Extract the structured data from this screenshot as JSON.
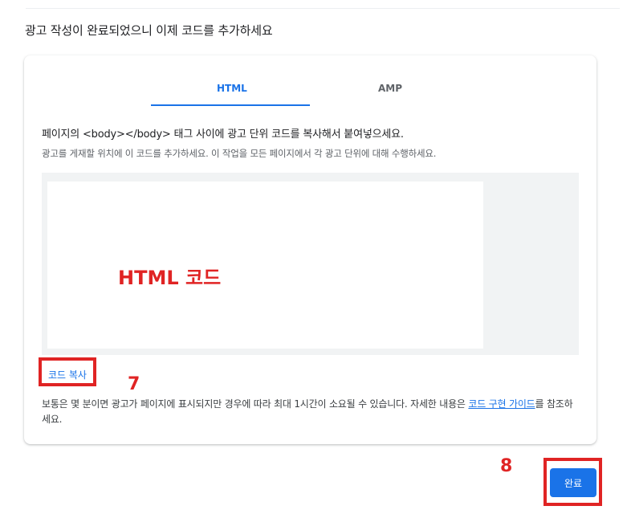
{
  "heading": "광고 작성이 완료되었으니 이제 코드를 추가하세요",
  "tabs": {
    "html": "HTML",
    "amp": "AMP"
  },
  "instruction": "페이지의 <body></body> 태그 사이에 광고 단위 코드를 복사해서 붙여넣으세요.",
  "subtext": "광고를 게재할 위치에 이 코드를 추가하세요. 이 작업을 모든 페이지에서 각 광고 단위에 대해 수행하세요.",
  "code_annotation": "HTML 코드",
  "copy_label": "코드 복사",
  "footer": {
    "text_before": "보통은 몇 분이면 광고가 페이지에 표시되지만 경우에 따라 최대 1시간이 소요될 수 있습니다. 자세한 내용은 ",
    "link": "코드 구현 가이드",
    "text_after": "를 참조하세요."
  },
  "steps": {
    "copy": "7",
    "done": "8"
  },
  "done_label": "완료",
  "colors": {
    "accent": "#1a73e8",
    "annotation": "#e02424"
  }
}
